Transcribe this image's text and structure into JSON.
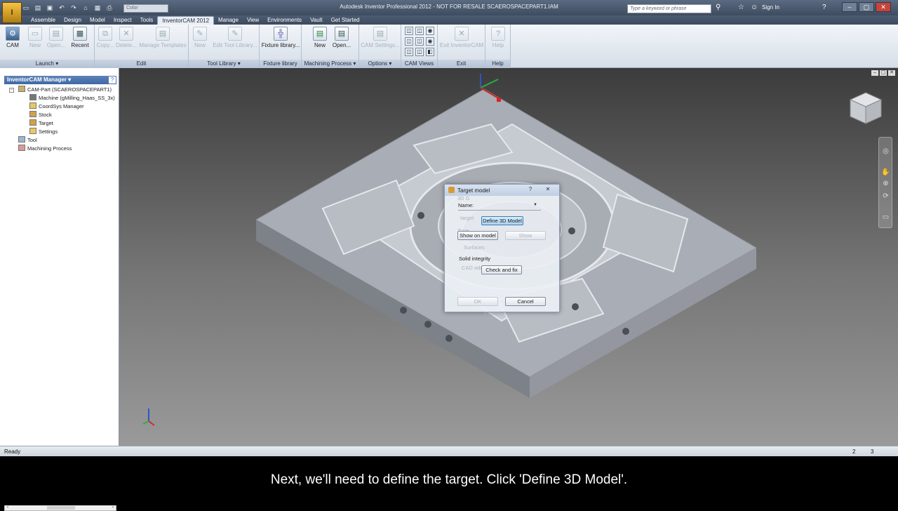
{
  "window": {
    "title": "Autodesk Inventor Professional 2012 - NOT FOR RESALE    SCAEROSPACEPART1.IAM",
    "search_placeholder": "Type a keyword or phrase",
    "sign_in": "Sign In",
    "color_box": "Color",
    "app_menu": "I"
  },
  "tabs": [
    "Assemble",
    "Design",
    "Model",
    "Inspect",
    "Tools",
    "InventorCAM 2012",
    "Manage",
    "View",
    "Environments",
    "Vault",
    "Get Started"
  ],
  "ribbon": {
    "panels": {
      "launch": "Launch ▾",
      "edit": "Edit",
      "tool_library": "Tool Library ▾",
      "fixture_library": "Fixture library",
      "machining_process": "Machining Process ▾",
      "options": "Options ▾",
      "cam_views": "CAM Views",
      "exit": "Exit",
      "help": "Help"
    },
    "buttons": {
      "cam": "CAM",
      "new": "New",
      "open": "Open...",
      "recent": "Recent",
      "copy": "Copy...",
      "delete": "Delete...",
      "manage_templates": "Manage Templates",
      "tl_new": "New",
      "edit_tool_library": "Edit Tool Library...",
      "fixture_library": "Fixture library...",
      "mp_new": "New",
      "mp_open": "Open...",
      "cam_settings": "CAM Settings...",
      "exit_inventorcam": "Exit InventorCAM",
      "help": "Help"
    }
  },
  "sidebar": {
    "header": "InventorCAM Manager ▾",
    "help": "?",
    "items": [
      {
        "label": "CAM-Part (SCAEROSPACEPART1)"
      },
      {
        "label": "Machine (gMilling_Haas_SS_3x)"
      },
      {
        "label": "CoordSys Manager"
      },
      {
        "label": "Stock"
      },
      {
        "label": "Target"
      },
      {
        "label": "Settings"
      },
      {
        "label": "Tool"
      },
      {
        "label": "Machining Process"
      }
    ]
  },
  "dialog": {
    "title": "Target model",
    "help": "?",
    "close": "✕",
    "name_label": "Name:",
    "ghost_3d": "3D G",
    "ghost_target": "target",
    "ghost_type": "Type",
    "define_3d_model": "Define 3D Model",
    "show_on_model": "Show on model",
    "show": "Show",
    "surfaces": "Surfaces",
    "solid_integrity": "Solid integrity",
    "cad_add": "CAD add",
    "check_and_fix": "Check and fix",
    "ok": "OK",
    "cancel": "Cancel",
    "cancel_ghost": "Cancel"
  },
  "status": {
    "text": "Ready",
    "n1": "2",
    "n2": "3"
  },
  "caption": "Next, we'll need to define the target. Click 'Define 3D Model'.",
  "colors": {
    "accent": "#3e68a3",
    "ribbon_bg": "#dde4ee",
    "viewport_top": "#3c3c3c",
    "viewport_bottom": "#9a9a9a"
  }
}
